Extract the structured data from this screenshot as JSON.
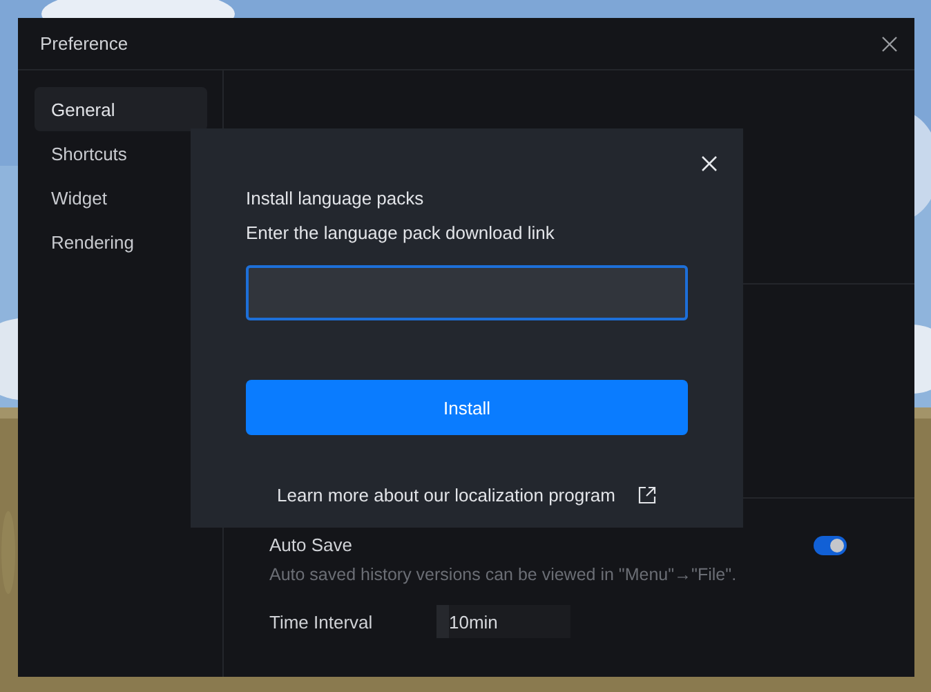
{
  "window": {
    "title": "Preference"
  },
  "sidebar": {
    "items": [
      {
        "label": "General",
        "selected": true
      },
      {
        "label": "Shortcuts",
        "selected": false
      },
      {
        "label": "Widget",
        "selected": false
      },
      {
        "label": "Rendering",
        "selected": false
      }
    ]
  },
  "settings": {
    "auto_save": {
      "label": "Auto Save",
      "on": true,
      "description": "Auto saved history versions can be viewed in \"Menu\"→\"File\"."
    },
    "time_interval": {
      "label": "Time Interval",
      "value": "10min"
    }
  },
  "dialog": {
    "title": "Install language packs",
    "prompt": "Enter the language pack download link",
    "install_button": "Install",
    "link": "Learn more about our localization program"
  }
}
